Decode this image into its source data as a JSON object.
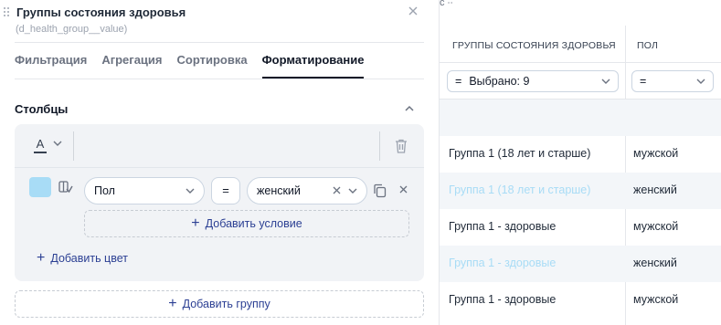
{
  "panel": {
    "title": "Группы состояния здоровья",
    "subtitle": "(d_health_group__value)",
    "tabs": [
      {
        "label": "Фильтрация",
        "active": false
      },
      {
        "label": "Агрегация",
        "active": false
      },
      {
        "label": "Сортировка",
        "active": false
      },
      {
        "label": "Форматирование",
        "active": true
      }
    ],
    "section_title": "Столбцы",
    "group": {
      "font_icon_letter": "A",
      "swatch_color": "#a8dcf6",
      "condition": {
        "field": "Пол",
        "operator": "=",
        "value": "женский"
      },
      "add_condition_label": "Добавить условие",
      "add_color_label": "Добавить цвет"
    },
    "add_group_label": "Добавить группу"
  },
  "table": {
    "top_fragment": "с  ∙∙",
    "columns": [
      {
        "header": "ГРУППЫ СОСТОЯНИЯ ЗДОРОВЬЯ",
        "filter_operator": "=",
        "filter_value": "Выбрано: 9"
      },
      {
        "header": "ПОЛ",
        "filter_operator": "=",
        "filter_value": ""
      }
    ],
    "rows": [
      {
        "group": "",
        "sex": "",
        "highlight": false
      },
      {
        "group": "Группа 1 (18 лет и старше)",
        "sex": "мужской",
        "highlight": false
      },
      {
        "group": "Группа 1 (18 лет и старше)",
        "sex": "женский",
        "highlight": true
      },
      {
        "group": "Группа 1 - здоровые",
        "sex": "мужской",
        "highlight": false
      },
      {
        "group": "Группа 1 - здоровые",
        "sex": "женский",
        "highlight": true
      },
      {
        "group": "Группа 1 - здоровые",
        "sex": "мужской",
        "highlight": false
      }
    ],
    "highlight_color": "#a8dcf6",
    "alt_row_color": "#f3f6f9"
  },
  "colors": {
    "accent": "#2b3f93",
    "card_bg": "#f1f3f6"
  }
}
